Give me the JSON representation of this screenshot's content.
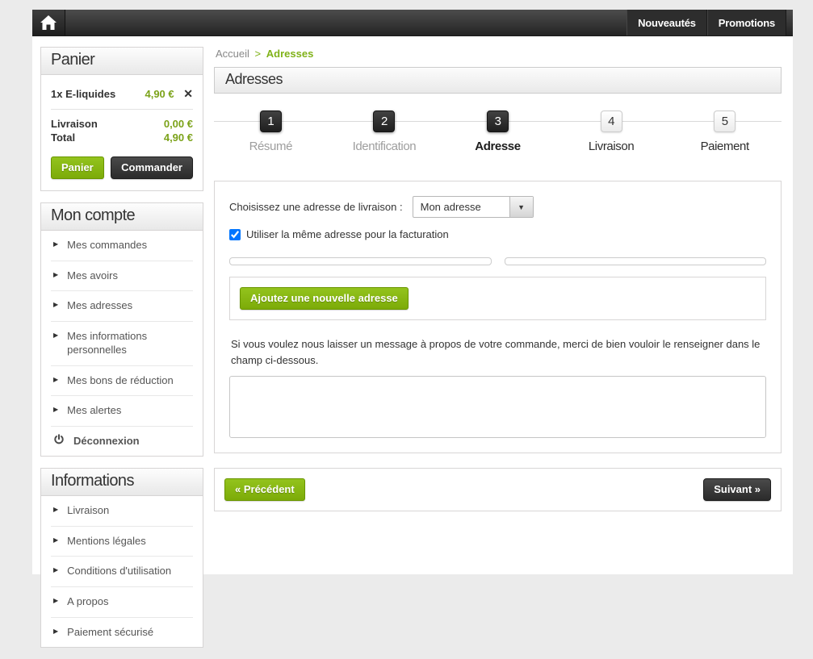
{
  "colors": {
    "accent_green": "#80b219",
    "green_text": "#7ba219",
    "navbar_dark": "#2d2d2d",
    "step_dark": "#2a2a2a"
  },
  "icons": {
    "home": "house",
    "remove": "✕",
    "bullet": "▶",
    "logout": "power",
    "dropdown_arrow": "▼"
  },
  "navbar": {
    "items": [
      {
        "label": "Nouveautés"
      },
      {
        "label": "Promotions"
      }
    ]
  },
  "sidebar": {
    "cart": {
      "title": "Panier",
      "item_label": "1x E-liquides",
      "item_price": "4,90 €",
      "shipping_label": "Livraison",
      "shipping_value": "0,00 €",
      "total_label": "Total",
      "total_value": "4,90 €",
      "cart_button": "Panier",
      "checkout_button": "Commander"
    },
    "account": {
      "title": "Mon compte",
      "items": [
        "Mes commandes",
        "Mes avoirs",
        "Mes adresses",
        "Mes informations personnelles",
        "Mes bons de réduction",
        "Mes alertes"
      ],
      "logout": "Déconnexion"
    },
    "information": {
      "title": "Informations",
      "items": [
        "Livraison",
        "Mentions légales",
        "Conditions d'utilisation",
        "A propos",
        "Paiement sécurisé"
      ]
    }
  },
  "main": {
    "breadcrumb": {
      "home": "Accueil",
      "separator": ">",
      "current": "Adresses"
    },
    "title": "Adresses",
    "steps": [
      {
        "num": "1",
        "label": "Résumé"
      },
      {
        "num": "2",
        "label": "Identification"
      },
      {
        "num": "3",
        "label": "Adresse"
      },
      {
        "num": "4",
        "label": "Livraison"
      },
      {
        "num": "5",
        "label": "Paiement"
      }
    ],
    "form": {
      "address_select_label": "Choisissez une adresse de livraison :",
      "address_selected_value": "Mon adresse",
      "billing_checkbox_label": "Utiliser la même adresse pour la facturation",
      "add_address_button": "Ajoutez une nouvelle adresse",
      "message_hint": "Si vous voulez nous laisser un message à propos de votre commande, merci de bien vouloir le renseigner dans le champ ci-dessous.",
      "message_value": ""
    },
    "footer": {
      "prev_button": "« Précédent",
      "next_button": "Suivant »"
    }
  }
}
